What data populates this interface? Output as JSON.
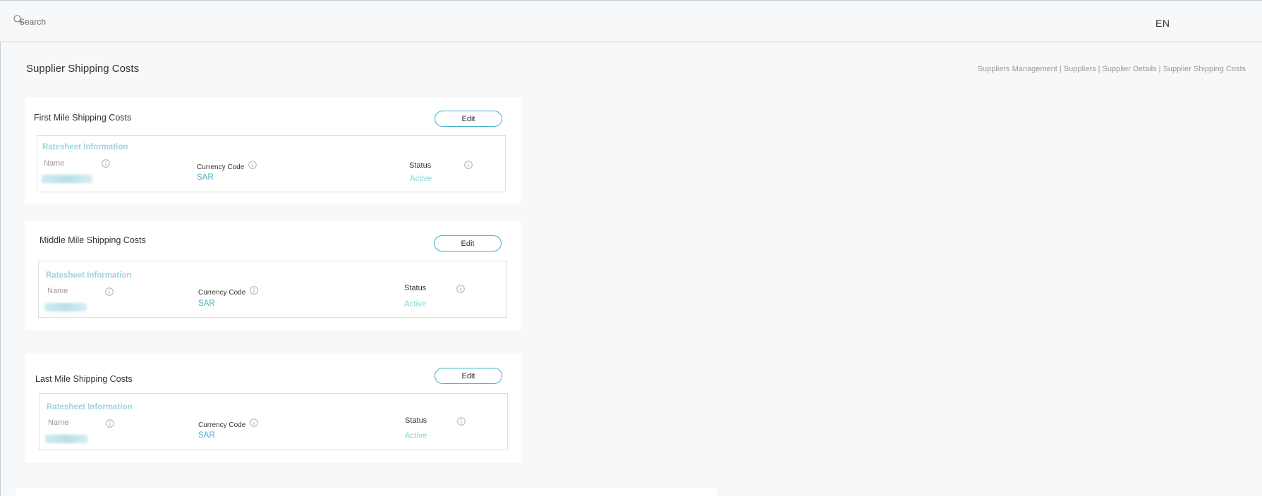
{
  "header": {
    "search_placeholder": "Search",
    "language": "EN"
  },
  "page": {
    "title": "Supplier Shipping Costs",
    "breadcrumb": "Suppliers Management | Suppliers | Supplier Details | Supplier Shipping Costs"
  },
  "sections": [
    {
      "title": "First Mile Shipping Costs",
      "edit_label": "Edit",
      "ratesheet": {
        "title": "Ratesheet Information",
        "name_label": "Name",
        "currency_label": "Currency Code",
        "currency_value": "SAR",
        "status_label": "Status",
        "status_value": "Active"
      }
    },
    {
      "title": "Middle Mile Shipping Costs",
      "edit_label": "Edit",
      "ratesheet": {
        "title": "Ratesheet Information",
        "name_label": "Name",
        "currency_label": "Currency Code",
        "currency_value": "SAR",
        "status_label": "Status",
        "status_value": "Active"
      }
    },
    {
      "title": "Last Mile Shipping Costs",
      "edit_label": "Edit",
      "ratesheet": {
        "title": "Ratesheet Information",
        "name_label": "Name",
        "currency_label": "Currency Code",
        "currency_value": "SAR",
        "status_label": "Status",
        "status_value": "Active"
      }
    }
  ],
  "colors": {
    "accent": "#3fb6c6",
    "link_blue": "#4fb1c4",
    "background": "#f7f8fa"
  },
  "icons": {
    "search": "search-icon",
    "info": "info-icon"
  }
}
